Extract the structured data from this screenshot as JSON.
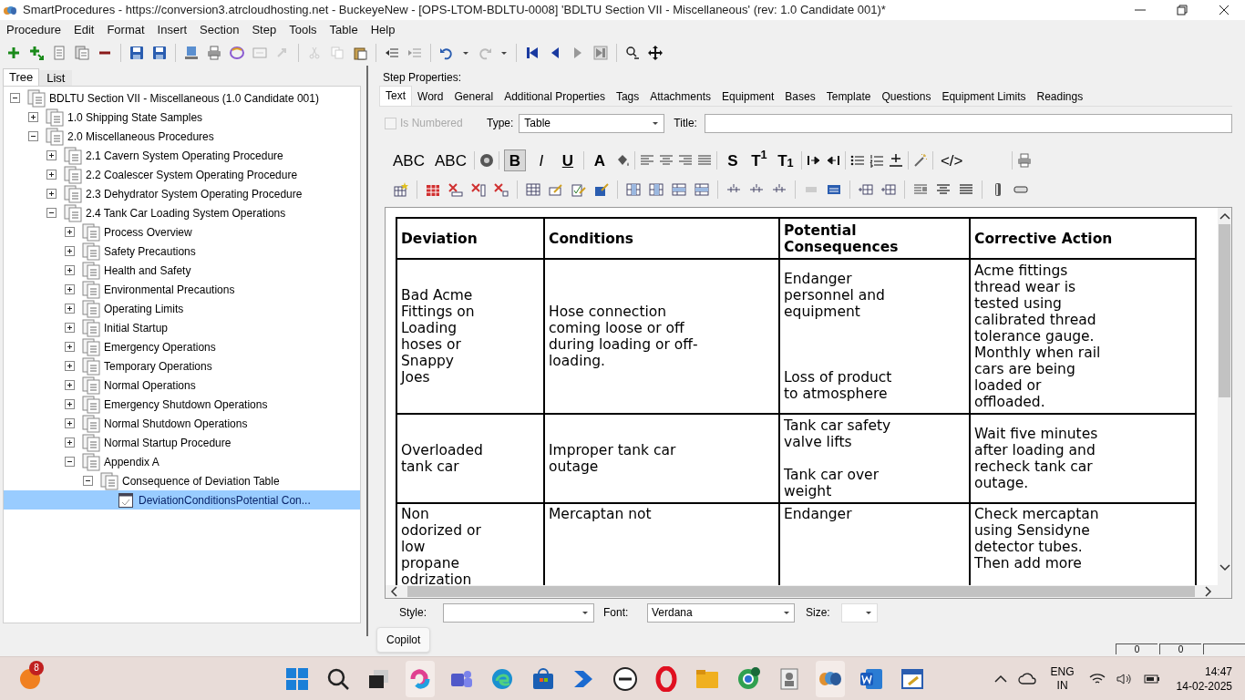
{
  "window": {
    "title": "SmartProcedures - https://conversion3.atrcloudhosting.net - BuckeyeNew - [OPS-LTOM-BDLTU-0008] 'BDLTU Section VII - Miscellaneous' (rev: 1.0 Candidate 001)*"
  },
  "menu": [
    "Procedure",
    "Edit",
    "Format",
    "Insert",
    "Section",
    "Step",
    "Tools",
    "Table",
    "Help"
  ],
  "left_tabs": [
    {
      "label": "Tree",
      "selected": true
    },
    {
      "label": "List",
      "selected": false
    }
  ],
  "tree": [
    {
      "label": "BDLTU Section VII - Miscellaneous (1.0 Candidate 001)",
      "kind": "section",
      "expanded": true,
      "selected": false,
      "children": [
        {
          "label": "1.0 Shipping State Samples",
          "kind": "section",
          "expanded": false,
          "selected": false
        },
        {
          "label": "2.0 Miscellaneous Procedures",
          "kind": "section",
          "expanded": true,
          "selected": false,
          "children": [
            {
              "label": "2.1 Cavern System Operating Procedure",
              "kind": "section",
              "expanded": false,
              "selected": false
            },
            {
              "label": "2.2 Coalescer System Operating Procedure",
              "kind": "section",
              "expanded": false,
              "selected": false
            },
            {
              "label": "2.3 Dehydrator System Operating Procedure",
              "kind": "section",
              "expanded": false,
              "selected": false
            },
            {
              "label": "2.4 Tank Car Loading System Operations",
              "kind": "section",
              "expanded": true,
              "selected": false,
              "children": [
                {
                  "label": "Process Overview",
                  "kind": "section",
                  "expanded": false,
                  "selected": false
                },
                {
                  "label": "Safety Precautions",
                  "kind": "section",
                  "expanded": false,
                  "selected": false
                },
                {
                  "label": "Health and Safety",
                  "kind": "section",
                  "expanded": false,
                  "selected": false
                },
                {
                  "label": "Environmental Precautions",
                  "kind": "section",
                  "expanded": false,
                  "selected": false
                },
                {
                  "label": "Operating Limits",
                  "kind": "section",
                  "expanded": false,
                  "selected": false
                },
                {
                  "label": "Initial Startup",
                  "kind": "section",
                  "expanded": false,
                  "selected": false
                },
                {
                  "label": "Emergency Operations",
                  "kind": "section",
                  "expanded": false,
                  "selected": false
                },
                {
                  "label": "Temporary Operations",
                  "kind": "section",
                  "expanded": false,
                  "selected": false
                },
                {
                  "label": "Normal Operations",
                  "kind": "section",
                  "expanded": false,
                  "selected": false
                },
                {
                  "label": "Emergency Shutdown Operations",
                  "kind": "section",
                  "expanded": false,
                  "selected": false
                },
                {
                  "label": "Normal Shutdown Operations",
                  "kind": "section",
                  "expanded": false,
                  "selected": false
                },
                {
                  "label": "Normal Startup Procedure",
                  "kind": "section",
                  "expanded": false,
                  "selected": false
                },
                {
                  "label": "Appendix A",
                  "kind": "section",
                  "expanded": true,
                  "selected": false,
                  "children": [
                    {
                      "label": "Consequence of Deviation Table",
                      "kind": "section",
                      "expanded": true,
                      "selected": false,
                      "children": [
                        {
                          "label": "DeviationConditionsPotential Con...",
                          "kind": "table",
                          "selected": true
                        }
                      ]
                    }
                  ]
                }
              ]
            }
          ]
        }
      ]
    }
  ],
  "step_properties": {
    "label": "Step Properties:",
    "tabs": [
      {
        "label": "Text",
        "selected": true
      },
      {
        "label": "Word",
        "selected": false
      },
      {
        "label": "General",
        "selected": false
      },
      {
        "label": "Additional Properties",
        "selected": false
      },
      {
        "label": "Tags",
        "selected": false
      },
      {
        "label": "Attachments",
        "selected": false
      },
      {
        "label": "Equipment",
        "selected": false
      },
      {
        "label": "Bases",
        "selected": false
      },
      {
        "label": "Template",
        "selected": false
      },
      {
        "label": "Questions",
        "selected": false
      },
      {
        "label": "Equipment Limits",
        "selected": false
      },
      {
        "label": "Readings",
        "selected": false
      }
    ],
    "is_numbered": {
      "label": "Is Numbered",
      "checked": false,
      "disabled": true
    },
    "type": {
      "label": "Type:",
      "value": "Table"
    },
    "title": {
      "label": "Title:"
    },
    "format_toolbar": [
      {
        "text": "ABC",
        "selected": false
      },
      {
        "text": "ABC",
        "selected": false
      },
      {
        "text": "B",
        "selected": true
      },
      {
        "text": "I",
        "selected": false
      },
      {
        "text": "U",
        "selected": false
      },
      {
        "text": "A",
        "selected": false
      },
      {
        "text": "S",
        "selected": false
      },
      {
        "text": "T$^{1}$",
        "selected": false
      },
      {
        "text": "T$_{1}$",
        "selected": false
      },
      {
        "text": "</>",
        "selected": false
      }
    ],
    "table": {
      "columns": [
        "Deviation",
        "Conditions",
        "Potential Consequences",
        "Corrective Action"
      ],
      "rows": [
        {
          "cells": [
            "Bad Acme Fittings on Loading hoses or Snappy Joes",
            "Hose connection coming loose or off during loading or off-loading.",
            "Endanger personnel and equipment\n\n\n\nLoss of product to atmosphere",
            "Acme fittings thread wear is tested using calibrated thread tolerance gauge. Monthly when rail cars are being loaded or offloaded."
          ]
        },
        {
          "cells": [
            "Overloaded tank car",
            "Improper tank car outage",
            "Tank car safety valve lifts\n\nTank car over weight",
            "Wait five minutes after loading and recheck tank car outage."
          ]
        },
        {
          "cells": [
            "Non odorized or low propane odrization",
            "Mercaptan not",
            "Endanger",
            "Check mercaptan using Sensidyne detector tubes. Then add more"
          ]
        }
      ]
    },
    "style": {
      "label": "Style:"
    },
    "font": {
      "label": "Font:",
      "value": "Verdana"
    },
    "size": {
      "label": "Size:"
    }
  },
  "tooltip": "Copilot",
  "status_bar": [
    "0",
    "0"
  ],
  "taskbar": {
    "notification_badge": "8",
    "language": "ENG",
    "region": "IN",
    "time": "14:47",
    "date": "14-02-2025"
  }
}
